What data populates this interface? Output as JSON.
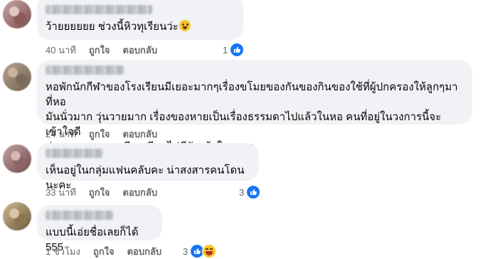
{
  "comments": [
    {
      "text": "ว้ายยยยยย ช่วงนี้หิวทุเรียนว่ะ",
      "time": "40 นาที",
      "like": "ถูกใจ",
      "reply": "ตอบกลับ",
      "reaction_count": "1",
      "reaction_icons": [
        "like-icon"
      ]
    },
    {
      "text": "หอพักนักกีฬาของโรงเรียนมีเยอะมากๆเรื่องขโมยของกันของกินของใช้ที่ผู้ปกครองให้ลูกๆมาที่หอ\nมันนั่วมาก วุ่นวายมาก เรื่องของหายเป็นเรื่องธรรมดาไปแล้วในหอ คนที่อยู่ในวงการนี้จะเข้าใจดี\nส่วน FC ของของทีมทุเรียนไม่มีวันเข้าใจหรอก",
      "time": "24 นาที",
      "like": "ถูกใจ",
      "reply": "ตอบกลับ",
      "reaction_count": "",
      "reaction_icons": []
    },
    {
      "text": "เห็นอยู่ในกลุ่มแฟนคลับคะ น่าสงสารคนโดนนะคะ",
      "time": "33 นาที",
      "like": "ถูกใจ",
      "reply": "ตอบกลับ",
      "reaction_count": "3",
      "reaction_icons": [
        "like-icon"
      ]
    },
    {
      "text": "แบบนี้เอ่ยชื่อเลยก็ได้ 555",
      "time": "1 ชั่วโมง",
      "like": "ถูกใจ",
      "reply": "ตอบกลับ",
      "reaction_count": "3",
      "reaction_icons": [
        "like-icon",
        "haha-icon"
      ]
    }
  ],
  "colors": {
    "bubble": "#f0f2f5",
    "meta_text": "#65676b",
    "like_blue": "#1877f2",
    "haha_yellow": "#f7c531"
  }
}
